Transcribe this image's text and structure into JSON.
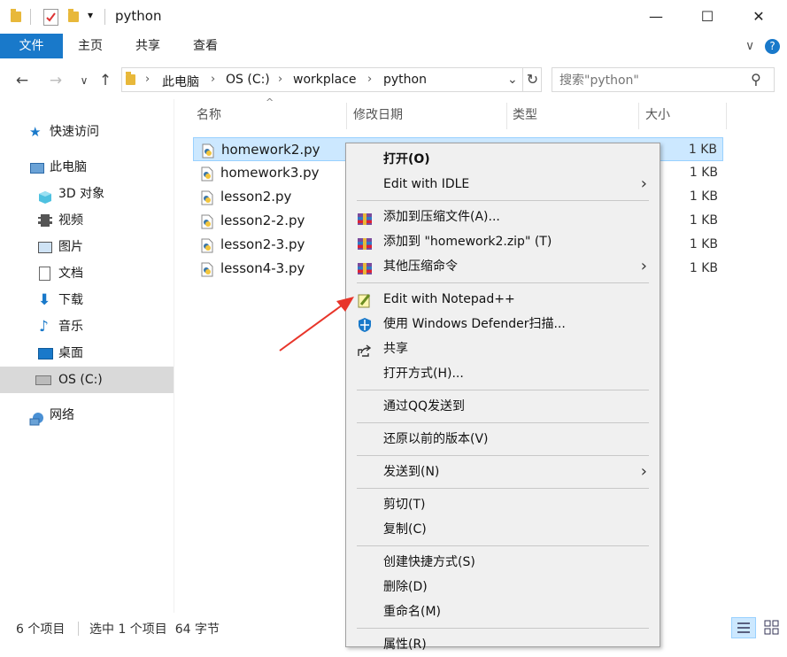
{
  "window": {
    "title": "python",
    "minimize": "—",
    "maximize": "☐",
    "close": "✕",
    "qat_dropdown": "▾"
  },
  "ribbon": {
    "tabs": [
      "文件",
      "主页",
      "共享",
      "查看"
    ],
    "expand": "∨",
    "help": "?"
  },
  "address": {
    "breadcrumb": [
      "此电脑",
      "OS (C:)",
      "workplace",
      "python"
    ],
    "refresh": "↻",
    "dropdown": "⌄"
  },
  "search": {
    "placeholder": "搜索\"python\"",
    "icon": "⚲"
  },
  "nav": {
    "items": [
      {
        "label": "快速访问",
        "icon": "star-icon",
        "selected": false
      },
      {
        "label": "此电脑",
        "icon": "computer-icon",
        "selected": false
      },
      {
        "label": "3D 对象",
        "icon": "cube-icon",
        "selected": false
      },
      {
        "label": "视频",
        "icon": "video-icon",
        "selected": false
      },
      {
        "label": "图片",
        "icon": "picture-icon",
        "selected": false
      },
      {
        "label": "文档",
        "icon": "document-icon",
        "selected": false
      },
      {
        "label": "下载",
        "icon": "download-icon",
        "selected": false
      },
      {
        "label": "音乐",
        "icon": "music-icon",
        "selected": false
      },
      {
        "label": "桌面",
        "icon": "desktop-icon",
        "selected": false
      },
      {
        "label": "OS (C:)",
        "icon": "drive-icon",
        "selected": true
      },
      {
        "label": "网络",
        "icon": "network-icon",
        "selected": false
      }
    ]
  },
  "columns": {
    "name": "名称",
    "modified": "修改日期",
    "type": "类型",
    "size": "大小",
    "sort_indicator": "^"
  },
  "files": [
    {
      "name": "homework2.py",
      "size": "1 KB",
      "selected": true
    },
    {
      "name": "homework3.py",
      "size": "1 KB",
      "selected": false
    },
    {
      "name": "lesson2.py",
      "size": "1 KB",
      "selected": false
    },
    {
      "name": "lesson2-2.py",
      "size": "1 KB",
      "selected": false
    },
    {
      "name": "lesson2-3.py",
      "size": "1 KB",
      "selected": false
    },
    {
      "name": "lesson4-3.py",
      "size": "1 KB",
      "selected": false
    }
  ],
  "context_menu": {
    "items": [
      {
        "label": "打开(O)",
        "bold": true
      },
      {
        "label": "Edit with IDLE",
        "submenu": true
      },
      {
        "sep": true
      },
      {
        "label": "添加到压缩文件(A)...",
        "icon": "archive-icon"
      },
      {
        "label": "添加到 \"homework2.zip\" (T)",
        "icon": "archive-icon"
      },
      {
        "label": "其他压缩命令",
        "icon": "archive-icon",
        "submenu": true
      },
      {
        "sep": true
      },
      {
        "label": "Edit with Notepad++",
        "icon": "notepadpp-icon"
      },
      {
        "label": "使用 Windows Defender扫描...",
        "icon": "defender-icon"
      },
      {
        "label": "共享",
        "icon": "share-icon"
      },
      {
        "label": "打开方式(H)..."
      },
      {
        "sep": true
      },
      {
        "label": "通过QQ发送到"
      },
      {
        "sep": true
      },
      {
        "label": "还原以前的版本(V)"
      },
      {
        "sep": true
      },
      {
        "label": "发送到(N)",
        "submenu": true
      },
      {
        "sep": true
      },
      {
        "label": "剪切(T)"
      },
      {
        "label": "复制(C)"
      },
      {
        "sep": true
      },
      {
        "label": "创建快捷方式(S)"
      },
      {
        "label": "删除(D)"
      },
      {
        "label": "重命名(M)"
      },
      {
        "sep": true
      },
      {
        "label": "属性(R)"
      }
    ]
  },
  "status": {
    "count": "6 个项目",
    "selection": "选中 1 个项目  64 字节"
  },
  "colors": {
    "accent": "#1979ca",
    "selection_bg": "#cce8ff",
    "annotation_arrow": "#e8352a"
  }
}
